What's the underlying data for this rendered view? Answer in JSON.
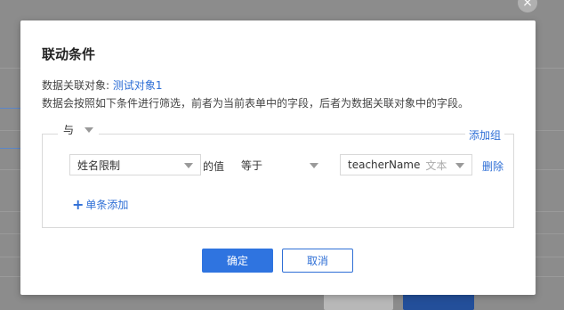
{
  "dialog": {
    "title": "联动条件",
    "related_object_label": "数据关联对象:",
    "related_object_value": "测试对象1",
    "description": "数据会按照如下条件进行筛选，前者为当前表单中的字段，后者为数据关联对象中的字段。",
    "group": {
      "operator": "与",
      "add_group_label": "添加组",
      "conditions": [
        {
          "field": "姓名限制",
          "value_label": "的值",
          "operator": "等于",
          "target_field": "teacherName",
          "target_type": "文本",
          "delete_label": "删除"
        }
      ],
      "add_condition_label": "单条添加"
    },
    "confirm_label": "确定",
    "cancel_label": "取消"
  },
  "background": {
    "close_glyph": "×"
  },
  "colors": {
    "accent": "#2f74e0",
    "link": "#2f6fd6",
    "overlay": "#8c8c8c"
  }
}
